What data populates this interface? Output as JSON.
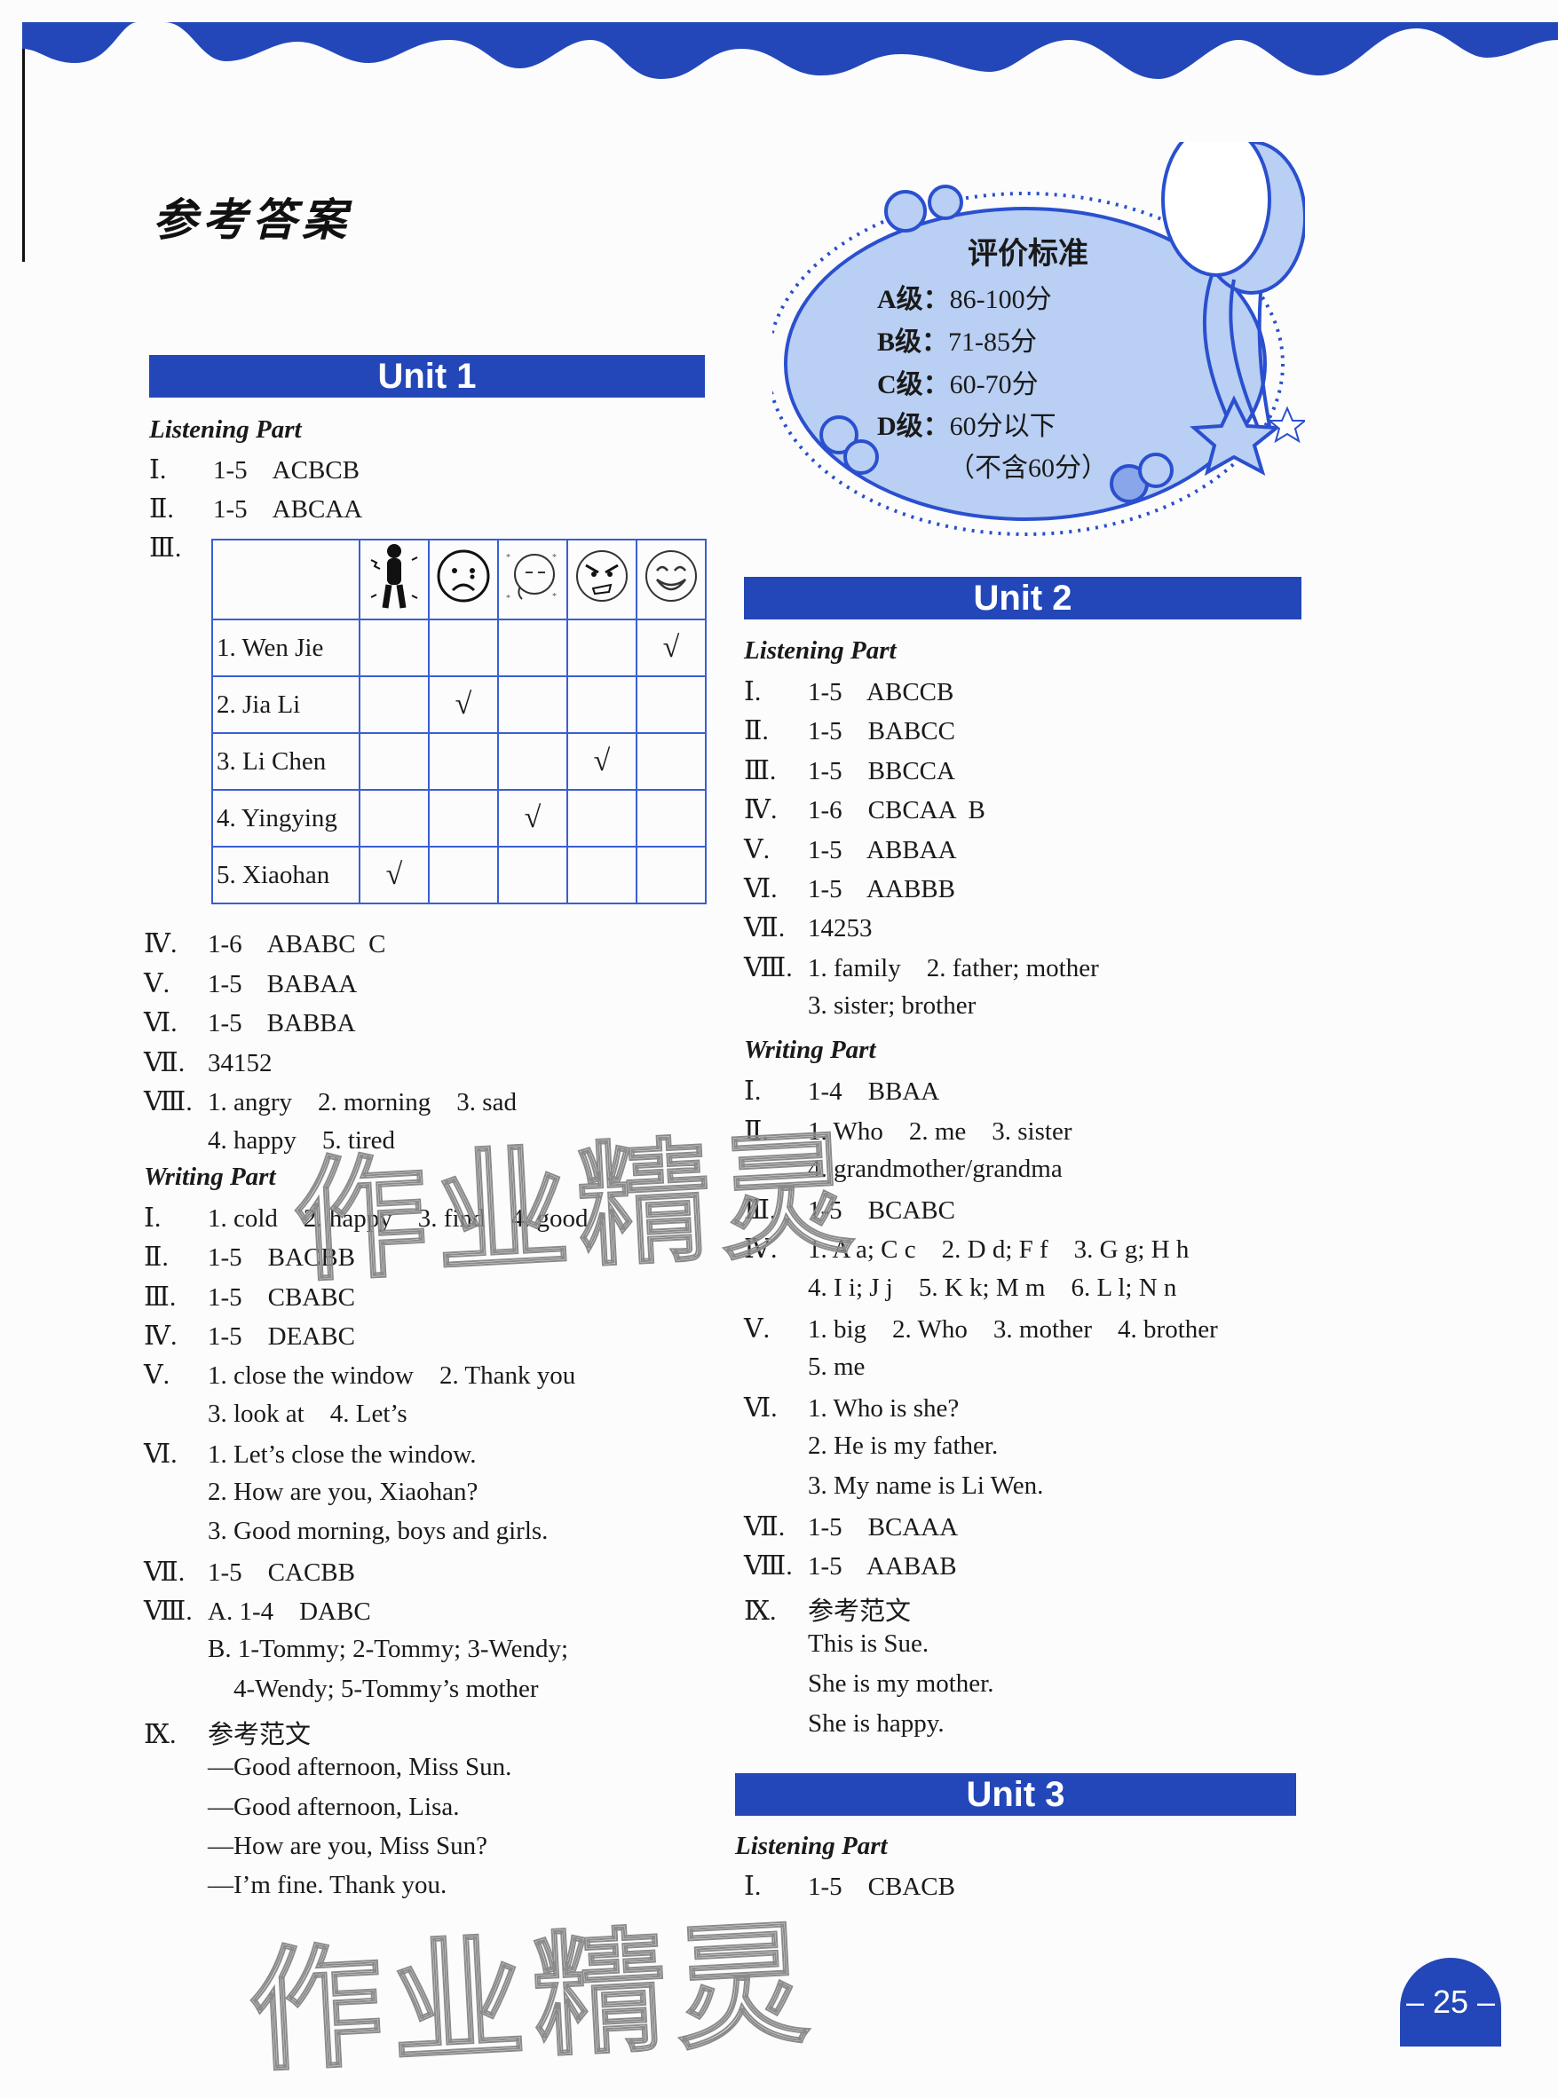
{
  "page_title": "参考答案",
  "page_number": "– 25 –",
  "watermark": "作业精灵",
  "rating": {
    "title": "评价标准",
    "levels": [
      {
        "label": "A级：",
        "range": "86-100分"
      },
      {
        "label": "B级：",
        "range": "71-85分"
      },
      {
        "label": "C级：",
        "range": "60-70分"
      },
      {
        "label": "D级：",
        "range": "60分以下"
      }
    ],
    "note": "（不含60分）"
  },
  "unit1": {
    "title": "Unit 1",
    "listening_title": "Listening Part",
    "listening": [
      {
        "num": "Ⅰ.",
        "text": "1-5",
        "answer": "ACBCB"
      },
      {
        "num": "Ⅱ.",
        "text": "1-5",
        "answer": "ABCAA"
      },
      {
        "num": "Ⅲ.",
        "text": "",
        "answer": ""
      }
    ],
    "table": {
      "columns": [
        "cold/shivering",
        "sad/crying",
        "tired/sick",
        "angry",
        "happy"
      ],
      "rows": [
        {
          "name": "1. Wen Jie",
          "check": 4
        },
        {
          "name": "2. Jia Li",
          "check": 1
        },
        {
          "name": "3. Li Chen",
          "check": 3
        },
        {
          "name": "4. Yingying",
          "check": 2
        },
        {
          "name": "5. Xiaohan",
          "check": 0
        }
      ],
      "check_mark": "√"
    },
    "listening_more": [
      {
        "num": "Ⅳ.",
        "text": "1-6",
        "answer": "ABABC  C"
      },
      {
        "num": "Ⅴ.",
        "text": "1-5",
        "answer": "BABAA"
      },
      {
        "num": "Ⅵ.",
        "text": "1-5",
        "answer": "BABBA"
      },
      {
        "num": "Ⅶ.",
        "text": "34152",
        "answer": ""
      },
      {
        "num": "Ⅷ.",
        "text": "1. angry    2. morning    3. sad",
        "answer": ""
      },
      {
        "num": "",
        "text": "4. happy    5. tired",
        "answer": ""
      }
    ],
    "writing_title": "Writing Part",
    "writing": [
      {
        "num": "Ⅰ.",
        "text": "1. cold    2. happy    3. find    4. good"
      },
      {
        "num": "Ⅱ.",
        "text": "1-5    BACBB"
      },
      {
        "num": "Ⅲ.",
        "text": "1-5    CBABC"
      },
      {
        "num": "Ⅳ.",
        "text": "1-5    DEABC"
      },
      {
        "num": "Ⅴ.",
        "text": "1. close the window    2. Thank you"
      },
      {
        "num": "",
        "text": "3. look at    4. Let’s"
      },
      {
        "num": "Ⅵ.",
        "text": "1. Let’s close the window."
      },
      {
        "num": "",
        "text": "2. How are you, Xiaohan?"
      },
      {
        "num": "",
        "text": "3. Good morning, boys and girls."
      },
      {
        "num": "Ⅶ.",
        "text": "1-5    CACBB"
      },
      {
        "num": "Ⅷ.",
        "text": "A. 1-4    DABC"
      },
      {
        "num": "",
        "text": "B. 1-Tommy; 2-Tommy; 3-Wendy;"
      },
      {
        "num": "",
        "text": "    4-Wendy; 5-Tommy’s mother"
      },
      {
        "num": "Ⅸ.",
        "text": "参考范文"
      },
      {
        "num": "",
        "text": "—Good afternoon, Miss Sun."
      },
      {
        "num": "",
        "text": "—Good afternoon, Lisa."
      },
      {
        "num": "",
        "text": "—How are you, Miss Sun?"
      },
      {
        "num": "",
        "text": "—I’m fine. Thank you."
      }
    ]
  },
  "unit2": {
    "title": "Unit 2",
    "listening_title": "Listening Part",
    "listening": [
      {
        "num": "Ⅰ.",
        "text": "1-5    ABCCB"
      },
      {
        "num": "Ⅱ.",
        "text": "1-5    BABCC"
      },
      {
        "num": "Ⅲ.",
        "text": "1-5    BBCCA"
      },
      {
        "num": "Ⅳ.",
        "text": "1-6    CBCAA  B"
      },
      {
        "num": "Ⅴ.",
        "text": "1-5    ABBAA"
      },
      {
        "num": "Ⅵ.",
        "text": "1-5    AABBB"
      },
      {
        "num": "Ⅶ.",
        "text": "14253"
      },
      {
        "num": "Ⅷ.",
        "text": "1. family    2. father; mother"
      },
      {
        "num": "",
        "text": "3. sister; brother"
      }
    ],
    "writing_title": "Writing Part",
    "writing": [
      {
        "num": "Ⅰ.",
        "text": "1-4    BBAA"
      },
      {
        "num": "Ⅱ.",
        "text": "1. Who    2. me    3. sister"
      },
      {
        "num": "",
        "text": "4. grandmother/grandma"
      },
      {
        "num": "Ⅲ.",
        "text": "1-5    BCABC"
      },
      {
        "num": "Ⅳ.",
        "text": "1. A a; C c    2. D d; F f    3. G g; H h"
      },
      {
        "num": "",
        "text": "4. I i; J j    5. K k; M m    6. L l; N n"
      },
      {
        "num": "Ⅴ.",
        "text": "1. big    2. Who    3. mother    4. brother"
      },
      {
        "num": "",
        "text": "5. me"
      },
      {
        "num": "Ⅵ.",
        "text": "1. Who is she?"
      },
      {
        "num": "",
        "text": "2. He is my father."
      },
      {
        "num": "",
        "text": "3. My name is Li Wen."
      },
      {
        "num": "Ⅶ.",
        "text": "1-5    BCAAA"
      },
      {
        "num": "Ⅷ.",
        "text": "1-5    AABAB"
      },
      {
        "num": "Ⅸ.",
        "text": "参考范文"
      },
      {
        "num": "",
        "text": "This is Sue."
      },
      {
        "num": "",
        "text": "She is my mother."
      },
      {
        "num": "",
        "text": "She is happy."
      }
    ]
  },
  "unit3": {
    "title": "Unit 3",
    "listening_title": "Listening Part",
    "listening": [
      {
        "num": "Ⅰ.",
        "text": "1-5    CBACB"
      }
    ]
  }
}
